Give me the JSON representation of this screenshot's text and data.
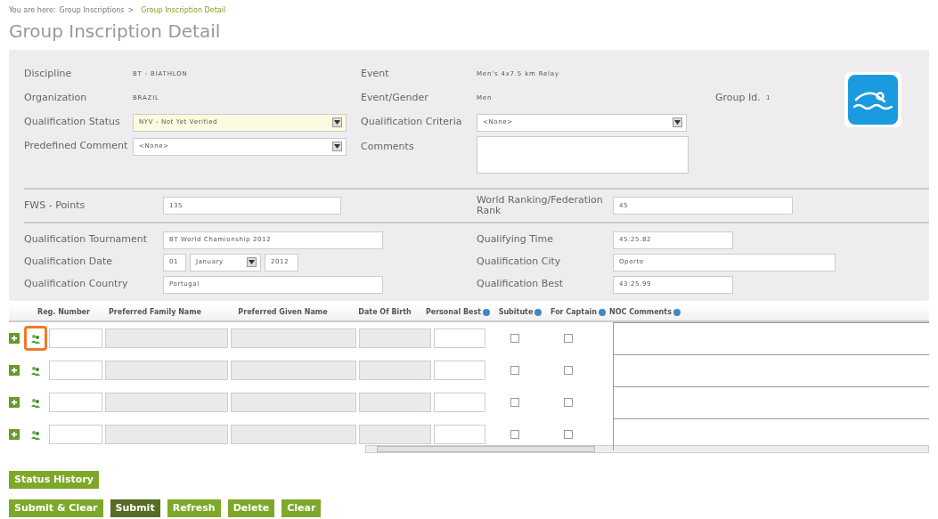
{
  "breadcrumb": {
    "label": "You are here:",
    "separator": ">",
    "items": [
      {
        "text": "Group Inscriptions",
        "current": false
      },
      {
        "text": "Group Inscription Detail",
        "current": true
      }
    ]
  },
  "title": "Group Inscription Detail",
  "details": {
    "discipline": {
      "label": "Discipline",
      "value": "BT - BIATHLON"
    },
    "event": {
      "label": "Event",
      "value": "Men's 4x7.5 km Relay"
    },
    "organization": {
      "label": "Organization",
      "value": "BRAZIL"
    },
    "event_gender": {
      "label": "Event/Gender",
      "value": "Men"
    },
    "group_id": {
      "label": "Group Id.",
      "value": "1"
    },
    "qualification_status": {
      "label": "Qualification Status",
      "value": "NYV - Not Yet Verified"
    },
    "qualification_criteria": {
      "label": "Qualification Criteria",
      "value": "<None>"
    },
    "predefined_comment": {
      "label": "Predefined Comment",
      "value": "<None>"
    },
    "comments": {
      "label": "Comments"
    }
  },
  "points": {
    "fws": {
      "label": "FWS - Points",
      "value": "135"
    },
    "ranking": {
      "label": "World Ranking/Federation Rank",
      "value": "45"
    }
  },
  "qualification": {
    "tournament": {
      "label": "Qualification Tournament",
      "value": "BT World Chamionship 2012"
    },
    "time": {
      "label": "Qualifying Time",
      "value": "45:25.82"
    },
    "date": {
      "label": "Qualification Date",
      "day": "01",
      "month": "January",
      "year": "2012"
    },
    "city": {
      "label": "Qualification City",
      "value": "Oporto"
    },
    "country": {
      "label": "Qualification Country",
      "value": "Portugal"
    },
    "best": {
      "label": "Qualification Best",
      "value": "43:25.99"
    }
  },
  "table": {
    "columns": [
      {
        "label": "Reg. Number",
        "info_icon": false
      },
      {
        "label": "Preferred Family Name",
        "info_icon": false
      },
      {
        "label": "Preferred Given Name",
        "info_icon": false
      },
      {
        "label": "Date Of Birth",
        "info_icon": false
      },
      {
        "label": "Personal Best",
        "info_icon": true
      },
      {
        "label": "Subitute",
        "info_icon": true
      },
      {
        "label": "For Captain",
        "info_icon": true
      },
      {
        "label": "NOC Comments",
        "info_icon": true
      }
    ],
    "rows": [
      {
        "substitute": false,
        "for_captain": false,
        "highlighted": true
      },
      {
        "substitute": false,
        "for_captain": false,
        "highlighted": false
      },
      {
        "substitute": false,
        "for_captain": false,
        "highlighted": false
      },
      {
        "substitute": false,
        "for_captain": false,
        "highlighted": false
      }
    ]
  },
  "status_history_button": "Status History",
  "buttons": [
    {
      "label": "Submit & Clear",
      "kind": "normal"
    },
    {
      "label": "Submit",
      "kind": "dark"
    },
    {
      "label": "Refresh",
      "kind": "normal"
    },
    {
      "label": "Delete",
      "kind": "normal"
    },
    {
      "label": "Clear",
      "kind": "normal"
    }
  ]
}
